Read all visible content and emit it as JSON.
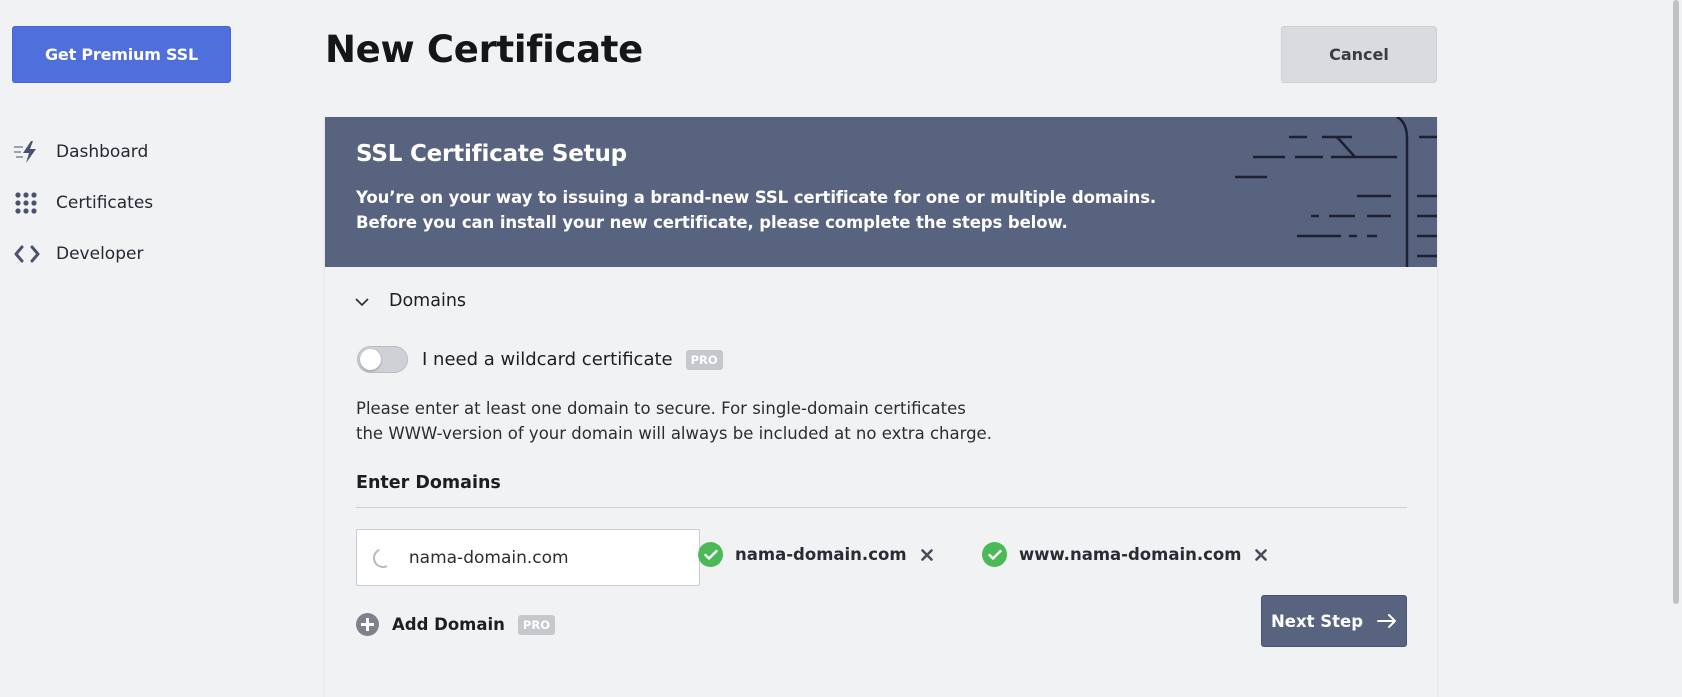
{
  "sidebar": {
    "premium_button": "Get Premium SSL",
    "items": [
      {
        "label": "Dashboard",
        "icon": "lightning-icon"
      },
      {
        "label": "Certificates",
        "icon": "grid-dots-icon"
      },
      {
        "label": "Developer",
        "icon": "code-brackets-icon"
      }
    ]
  },
  "header": {
    "title": "New Certificate",
    "cancel_label": "Cancel"
  },
  "card": {
    "title": "SSL Certificate Setup",
    "subtitle_line1": "You’re on your way to issuing a brand-new SSL certificate for one or multiple domains.",
    "subtitle_line2": "Before you can install your new certificate, please complete the steps below."
  },
  "domains_section": {
    "title": "Domains",
    "wildcard_label": "I need a wildcard certificate",
    "wildcard_enabled": false,
    "pro_badge": "PRO",
    "description_line1": "Please enter at least one domain to secure. For single-domain certificates",
    "description_line2": "the WWW-version of your domain will always be included at no extra charge.",
    "enter_label": "Enter Domains",
    "input_value": "nama-domain.com",
    "chips": [
      "nama-domain.com",
      "www.nama-domain.com"
    ],
    "add_domain_label": "Add Domain",
    "next_label": "Next Step"
  },
  "colors": {
    "accent_blue": "#4f6fdc",
    "header_slate": "#586380",
    "success_green": "#4cb957",
    "background": "#f1f2f4"
  }
}
